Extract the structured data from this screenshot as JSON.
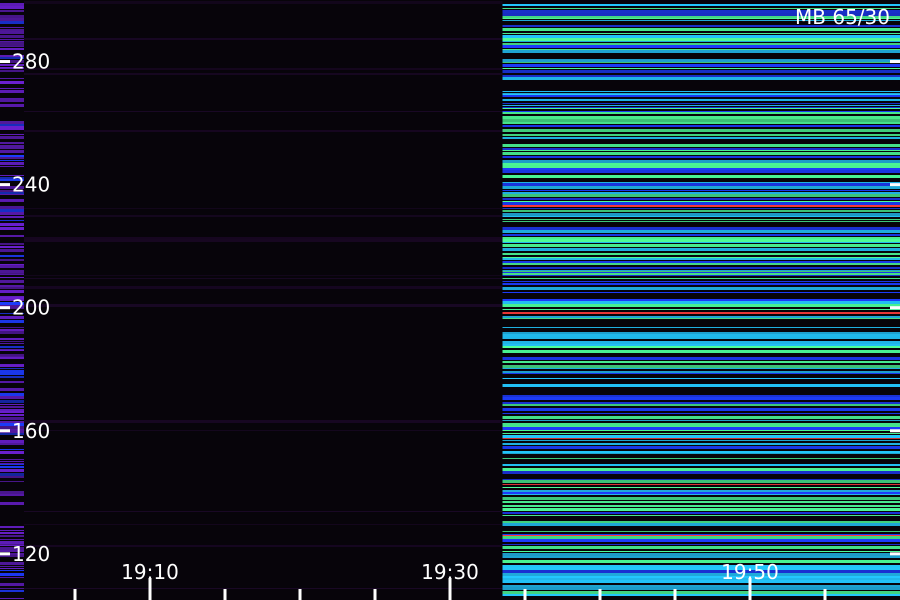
{
  "chart_data": {
    "type": "heatmap",
    "title": "",
    "xlabel": "",
    "ylabel": "",
    "corner_label": "MB 65/30",
    "x_range": [
      "19:00",
      "20:00"
    ],
    "x_ticks": [
      "19:10",
      "19:30",
      "19:50"
    ],
    "x_tick_values_minutes": [
      10,
      30,
      50
    ],
    "x_minor_tick_values_minutes": [
      5,
      15,
      20,
      25,
      35,
      40,
      45,
      55
    ],
    "y_range": [
      105,
      300
    ],
    "y_ticks": [
      "120",
      "160",
      "200",
      "240",
      "280"
    ],
    "y_tick_values": [
      120,
      160,
      200,
      240,
      280
    ],
    "segments": [
      {
        "name": "",
        "start_minute": 0,
        "end_minute": 1.6,
        "level": "low",
        "palette": "violet-blue"
      },
      {
        "name": "",
        "start_minute": 1.6,
        "end_minute": 33.5,
        "level": "very-low",
        "palette": "dark"
      },
      {
        "name": "",
        "start_minute": 33.5,
        "end_minute": 60,
        "level": "high",
        "palette": "blue-cyan-green"
      }
    ],
    "colors": {
      "background": "#07040a",
      "low": "#6a1fd0",
      "mid": "#1d3cff",
      "high_a": "#23c8ff",
      "high_b": "#4dff9a",
      "peak": "#ff3a3a",
      "ticks": "#ffffff"
    },
    "grid": false
  }
}
